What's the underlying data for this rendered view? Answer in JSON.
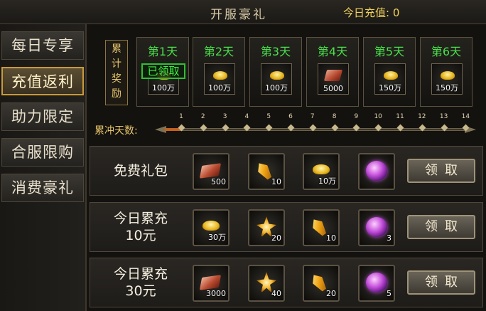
{
  "header": {
    "title": "开服豪礼",
    "recharge_label": "今日充值: 0"
  },
  "sidebar": {
    "items": [
      {
        "label": "每日专享",
        "active": false
      },
      {
        "label": "充值返利",
        "active": true
      },
      {
        "label": "助力限定",
        "active": false
      },
      {
        "label": "合服限购",
        "active": false
      },
      {
        "label": "消费豪礼",
        "active": false
      }
    ]
  },
  "cumulative": {
    "label": "累计奖励",
    "days": [
      {
        "title": "第1天",
        "amount": "100万",
        "item": "ingot-icon",
        "claimed_label": "已领取"
      },
      {
        "title": "第2天",
        "amount": "100万",
        "item": "ingot-icon"
      },
      {
        "title": "第3天",
        "amount": "100万",
        "item": "ingot-icon"
      },
      {
        "title": "第4天",
        "amount": "5000",
        "item": "book-icon"
      },
      {
        "title": "第5天",
        "amount": "150万",
        "item": "ingot-icon"
      },
      {
        "title": "第6天",
        "amount": "150万",
        "item": "ingot-icon"
      }
    ]
  },
  "progress": {
    "label": "累冲天数:",
    "ticks": [
      "1",
      "2",
      "3",
      "4",
      "5",
      "6",
      "7",
      "8",
      "9",
      "10",
      "11",
      "12",
      "13",
      "14"
    ],
    "current_day": 1
  },
  "rows": [
    {
      "title_line1": "免费礼包",
      "title_line2": "",
      "button": "领取",
      "items": [
        {
          "icon": "book-icon",
          "count": "500"
        },
        {
          "icon": "gem-icon",
          "count": "10"
        },
        {
          "icon": "ingot-icon",
          "count": "10万"
        },
        {
          "icon": "orb-icon",
          "count": ""
        }
      ]
    },
    {
      "title_line1": "今日累充",
      "title_line2": "10元",
      "button": "领取",
      "items": [
        {
          "icon": "ingot-icon",
          "count": "30万"
        },
        {
          "icon": "shard-icon",
          "count": "20"
        },
        {
          "icon": "gem-icon",
          "count": "10"
        },
        {
          "icon": "orb-icon",
          "count": "3"
        }
      ]
    },
    {
      "title_line1": "今日累充",
      "title_line2": "30元",
      "button": "领取",
      "items": [
        {
          "icon": "book-icon",
          "count": "3000"
        },
        {
          "icon": "shard-icon",
          "count": "40"
        },
        {
          "icon": "gem-icon",
          "count": "20"
        },
        {
          "icon": "orb-icon",
          "count": "5"
        }
      ]
    }
  ],
  "colors": {
    "day_title": "#49e04a",
    "accent_gold": "#e6c46a",
    "progress_fill": "#c1621f"
  }
}
